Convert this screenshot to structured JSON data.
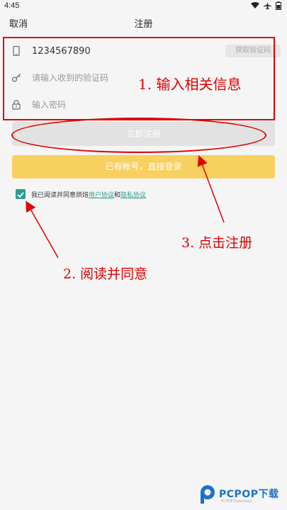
{
  "status_bar": {
    "time": "4:45"
  },
  "nav": {
    "cancel_label": "取消",
    "title": "注册"
  },
  "form": {
    "phone_value": "1234567890",
    "code_placeholder": "请输入收到的验证码",
    "password_placeholder": "输入密码",
    "get_code_label": "获取验证码"
  },
  "buttons": {
    "register_label": "立即注册",
    "login_label": "已有帐号，直接登录"
  },
  "agreement": {
    "checked": true,
    "prefix": "我已阅读并同意烘焙",
    "user_agreement": "用户协议",
    "conjunction": "和",
    "privacy_policy": "隐私协议"
  },
  "annotations": {
    "step1": "1. 输入相关信息",
    "step2": "2. 阅读并同意",
    "step3": "3.   点击注册",
    "color": "#e00000"
  },
  "watermark": {
    "brand": "PCPOP下载",
    "sub": "PCPOP Download"
  },
  "colors": {
    "accent": "#2a9d8f",
    "login_bg": "#f7d060",
    "register_bg": "#e2e2e2"
  }
}
